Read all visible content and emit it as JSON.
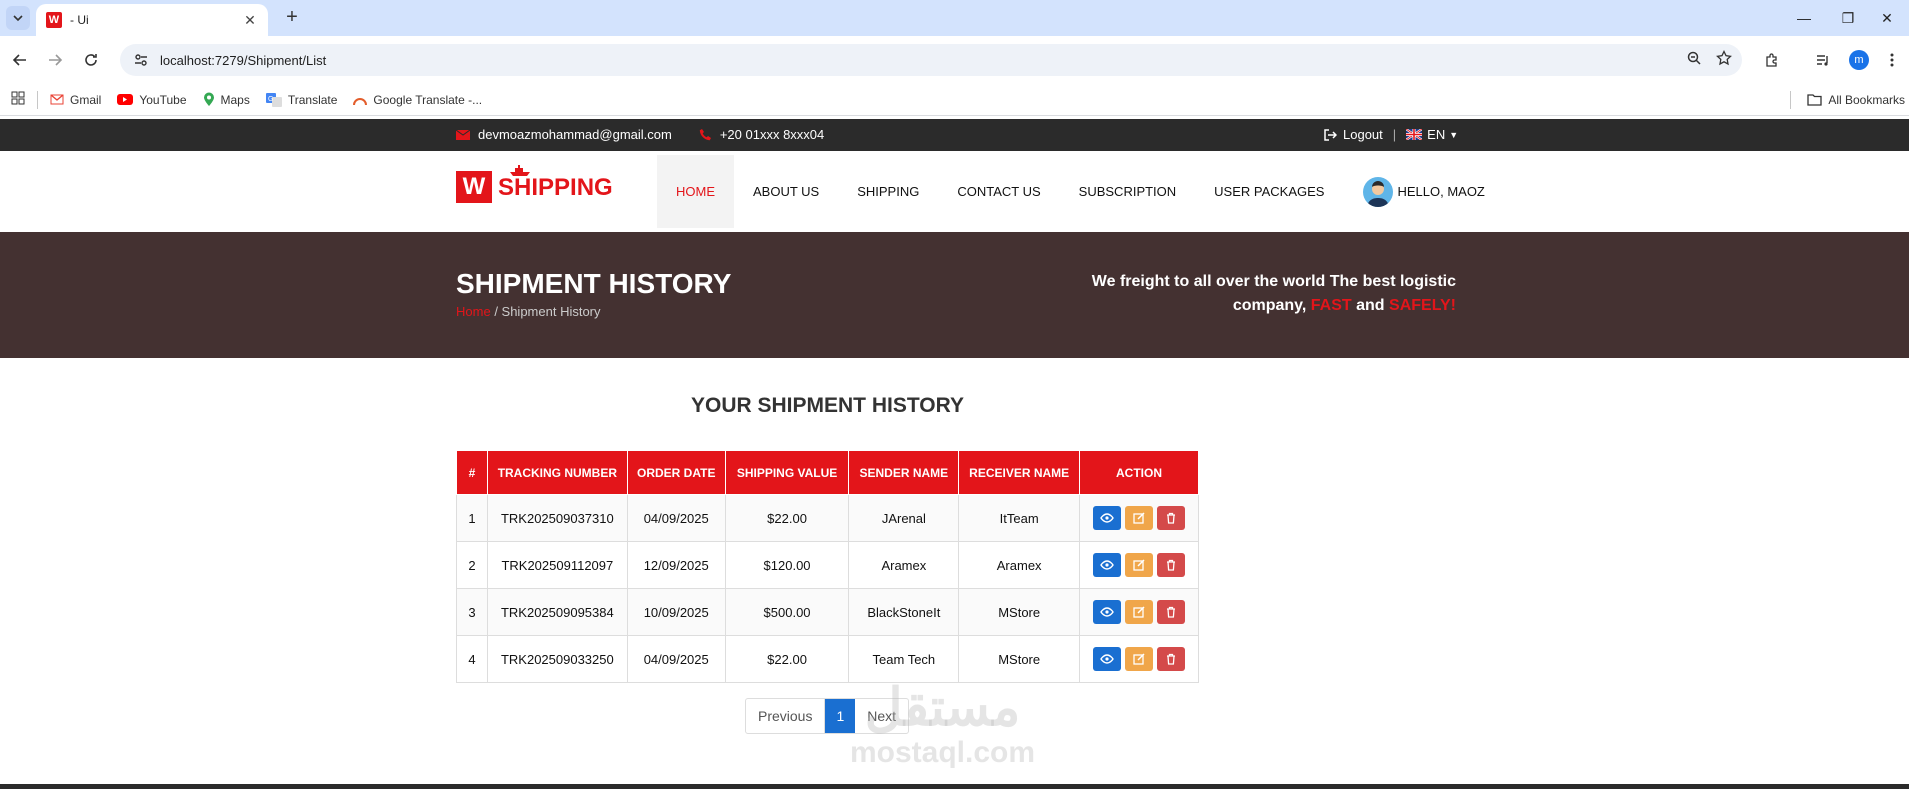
{
  "browser": {
    "tab_title": "- Ui",
    "tab_favicon_letter": "W",
    "url": "localhost:7279/Shipment/List",
    "bookmarks": [
      {
        "label": "Gmail",
        "icon": "gmail-icon"
      },
      {
        "label": "YouTube",
        "icon": "youtube-icon"
      },
      {
        "label": "Maps",
        "icon": "maps-icon"
      },
      {
        "label": "Translate",
        "icon": "translate-icon"
      },
      {
        "label": "Google Translate -...",
        "icon": "google-translate-icon"
      }
    ],
    "all_bookmarks": "All Bookmarks",
    "profile_initial": "m"
  },
  "topbar": {
    "email": "devmoazmohammad@gmail.com",
    "phone": "+20 01xxx 8xxx04",
    "logout": "Logout",
    "language": "EN"
  },
  "header": {
    "logo_letter": "W",
    "logo_text": "SHIPPING",
    "nav": [
      "HOME",
      "ABOUT US",
      "SHIPPING",
      "CONTACT US",
      "SUBSCRIPTION",
      "USER PACKAGES"
    ],
    "user_greeting": "HELLO, MAOZ"
  },
  "hero": {
    "title": "SHIPMENT HISTORY",
    "crumb_home": "Home",
    "crumb_current": "/ Shipment History",
    "tagline_line1": "We freight to all over the world The best logistic",
    "tagline_company": "company,",
    "tagline_fast": "FAST",
    "tagline_and": "and",
    "tagline_safely": "SAFELY!"
  },
  "main": {
    "section_title": "YOUR SHIPMENT HISTORY",
    "columns": [
      "#",
      "TRACKING NUMBER",
      "ORDER DATE",
      "SHIPPING VALUE",
      "SENDER NAME",
      "RECEIVER NAME",
      "ACTION"
    ],
    "rows": [
      {
        "n": "1",
        "tracking": "TRK202509037310",
        "date": "04/09/2025",
        "value": "$22.00",
        "sender": "JArenal",
        "receiver": "ItTeam"
      },
      {
        "n": "2",
        "tracking": "TRK202509112097",
        "date": "12/09/2025",
        "value": "$120.00",
        "sender": "Aramex",
        "receiver": "Aramex"
      },
      {
        "n": "3",
        "tracking": "TRK202509095384",
        "date": "10/09/2025",
        "value": "$500.00",
        "sender": "BlackStoneIt",
        "receiver": "MStore"
      },
      {
        "n": "4",
        "tracking": "TRK202509033250",
        "date": "04/09/2025",
        "value": "$22.00",
        "sender": "Team Tech",
        "receiver": "MStore"
      }
    ],
    "pager": {
      "previous": "Previous",
      "current": "1",
      "next": "Next"
    }
  },
  "watermark": {
    "arabic": "مستقل",
    "latin": "mostaql.com"
  },
  "colors": {
    "accent": "#e3151a",
    "hero_bg": "#443131",
    "topbar_bg": "#2b2b2b",
    "view_btn": "#1a6fd1",
    "edit_btn": "#f0a64a",
    "delete_btn": "#d44a4a"
  }
}
